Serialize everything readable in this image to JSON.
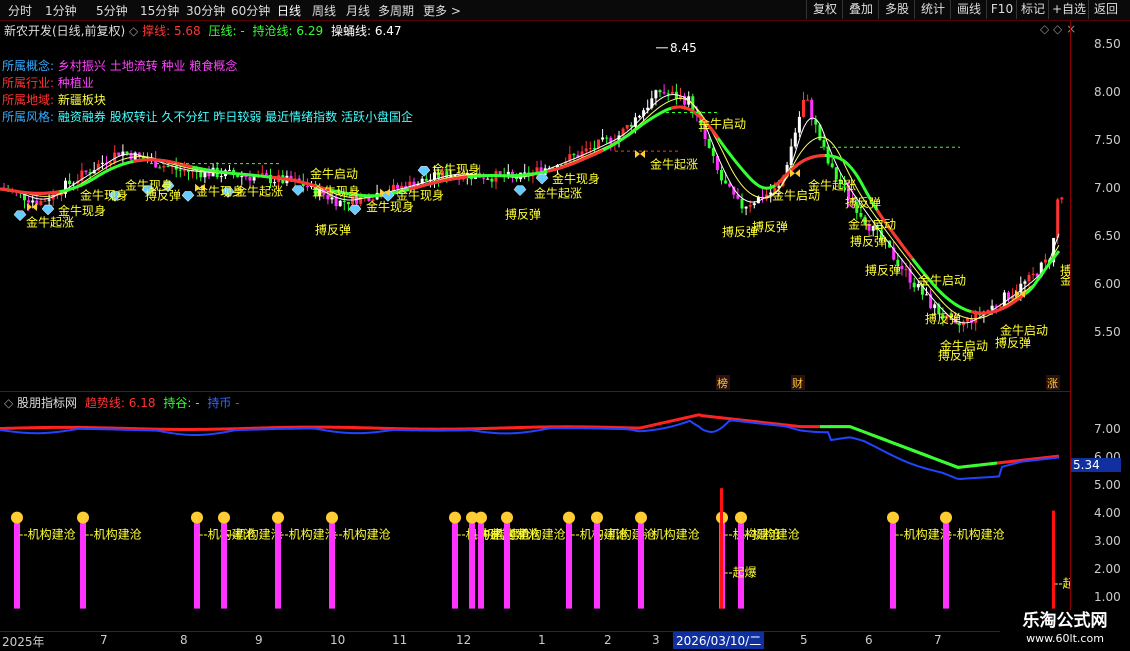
{
  "toolbar": {
    "periods": [
      "分时",
      "1分钟",
      "5分钟",
      "15分钟",
      "30分钟",
      "60分钟",
      "日线",
      "周线",
      "月线",
      "多周期",
      "更多 >"
    ],
    "buttons": [
      "复权",
      "叠加",
      "多股",
      "统计",
      "画线",
      "F10",
      "标记",
      "+自选",
      "返回"
    ]
  },
  "main_panel": {
    "title": "新农开发(日线,前复权)",
    "ma_items": [
      {
        "label": "撑线:",
        "value": "5.68",
        "color": "#ff3333"
      },
      {
        "label": "压线:",
        "value": "-",
        "color": "#33ff33"
      },
      {
        "label": "持沧线:",
        "value": "6.29",
        "color": "#33ff33"
      },
      {
        "label": "操蛹线:",
        "value": "6.47",
        "color": "#ffffff"
      }
    ],
    "info": [
      {
        "label": "所属概念:",
        "value": "乡村振兴 土地流转 种业 粮食概念",
        "value_color": "#ff44ff"
      },
      {
        "label": "所属行业:",
        "value": "种植业",
        "value_color": "#ff44ff"
      },
      {
        "label": "所属地域:",
        "value": "新疆板块",
        "value_color": "#ffff44"
      },
      {
        "label": "所属风格:",
        "value": "融资融券 股权转让 久不分红 昨日较弱 最近情绪指数 活跃小盘国企",
        "value_color": "#44ffff"
      }
    ],
    "high_label": "8.45",
    "y_ticks": [
      "8.50",
      "8.00",
      "7.50",
      "7.00",
      "6.50",
      "6.00",
      "5.50"
    ],
    "events": [
      "榜",
      "财",
      "涨"
    ]
  },
  "sub_panel": {
    "title": "股朋指标网",
    "items": [
      {
        "label": "趋势线:",
        "value": "6.18",
        "color": "#ff3333"
      },
      {
        "label": "持谷:",
        "value": "-",
        "color": "#33ff33"
      },
      {
        "label": "持币",
        "value": "-",
        "color": "#3366ff"
      }
    ],
    "y_ticks": [
      "7.00",
      "6.00",
      "5.00",
      "4.00",
      "3.00",
      "2.00",
      "1.00"
    ],
    "current_value": "5.34"
  },
  "annotations": {
    "jinniu_qidong": "金牛启动",
    "jinniu_xianshen": "金牛现身",
    "jinniu_qizhang": "金牛起涨",
    "bofantan": "搏反弹",
    "jigou": "机构建沧",
    "qibao": "起爆"
  },
  "x_axis": {
    "labels": [
      "2025年",
      "7",
      "8",
      "9",
      "10",
      "11",
      "12",
      "1",
      "2",
      "3",
      "4",
      "5",
      "6",
      "7"
    ],
    "cursor_date": "2026/03/10/二"
  },
  "watermark": {
    "title": "乐淘公式网",
    "url": "www.60lt.com"
  },
  "colors": {
    "up": "#ff3333",
    "down": "#33ff33",
    "yellow": "#ffff33",
    "magenta": "#ff33ff",
    "cyan": "#33ffff",
    "blue": "#3355ff"
  }
}
